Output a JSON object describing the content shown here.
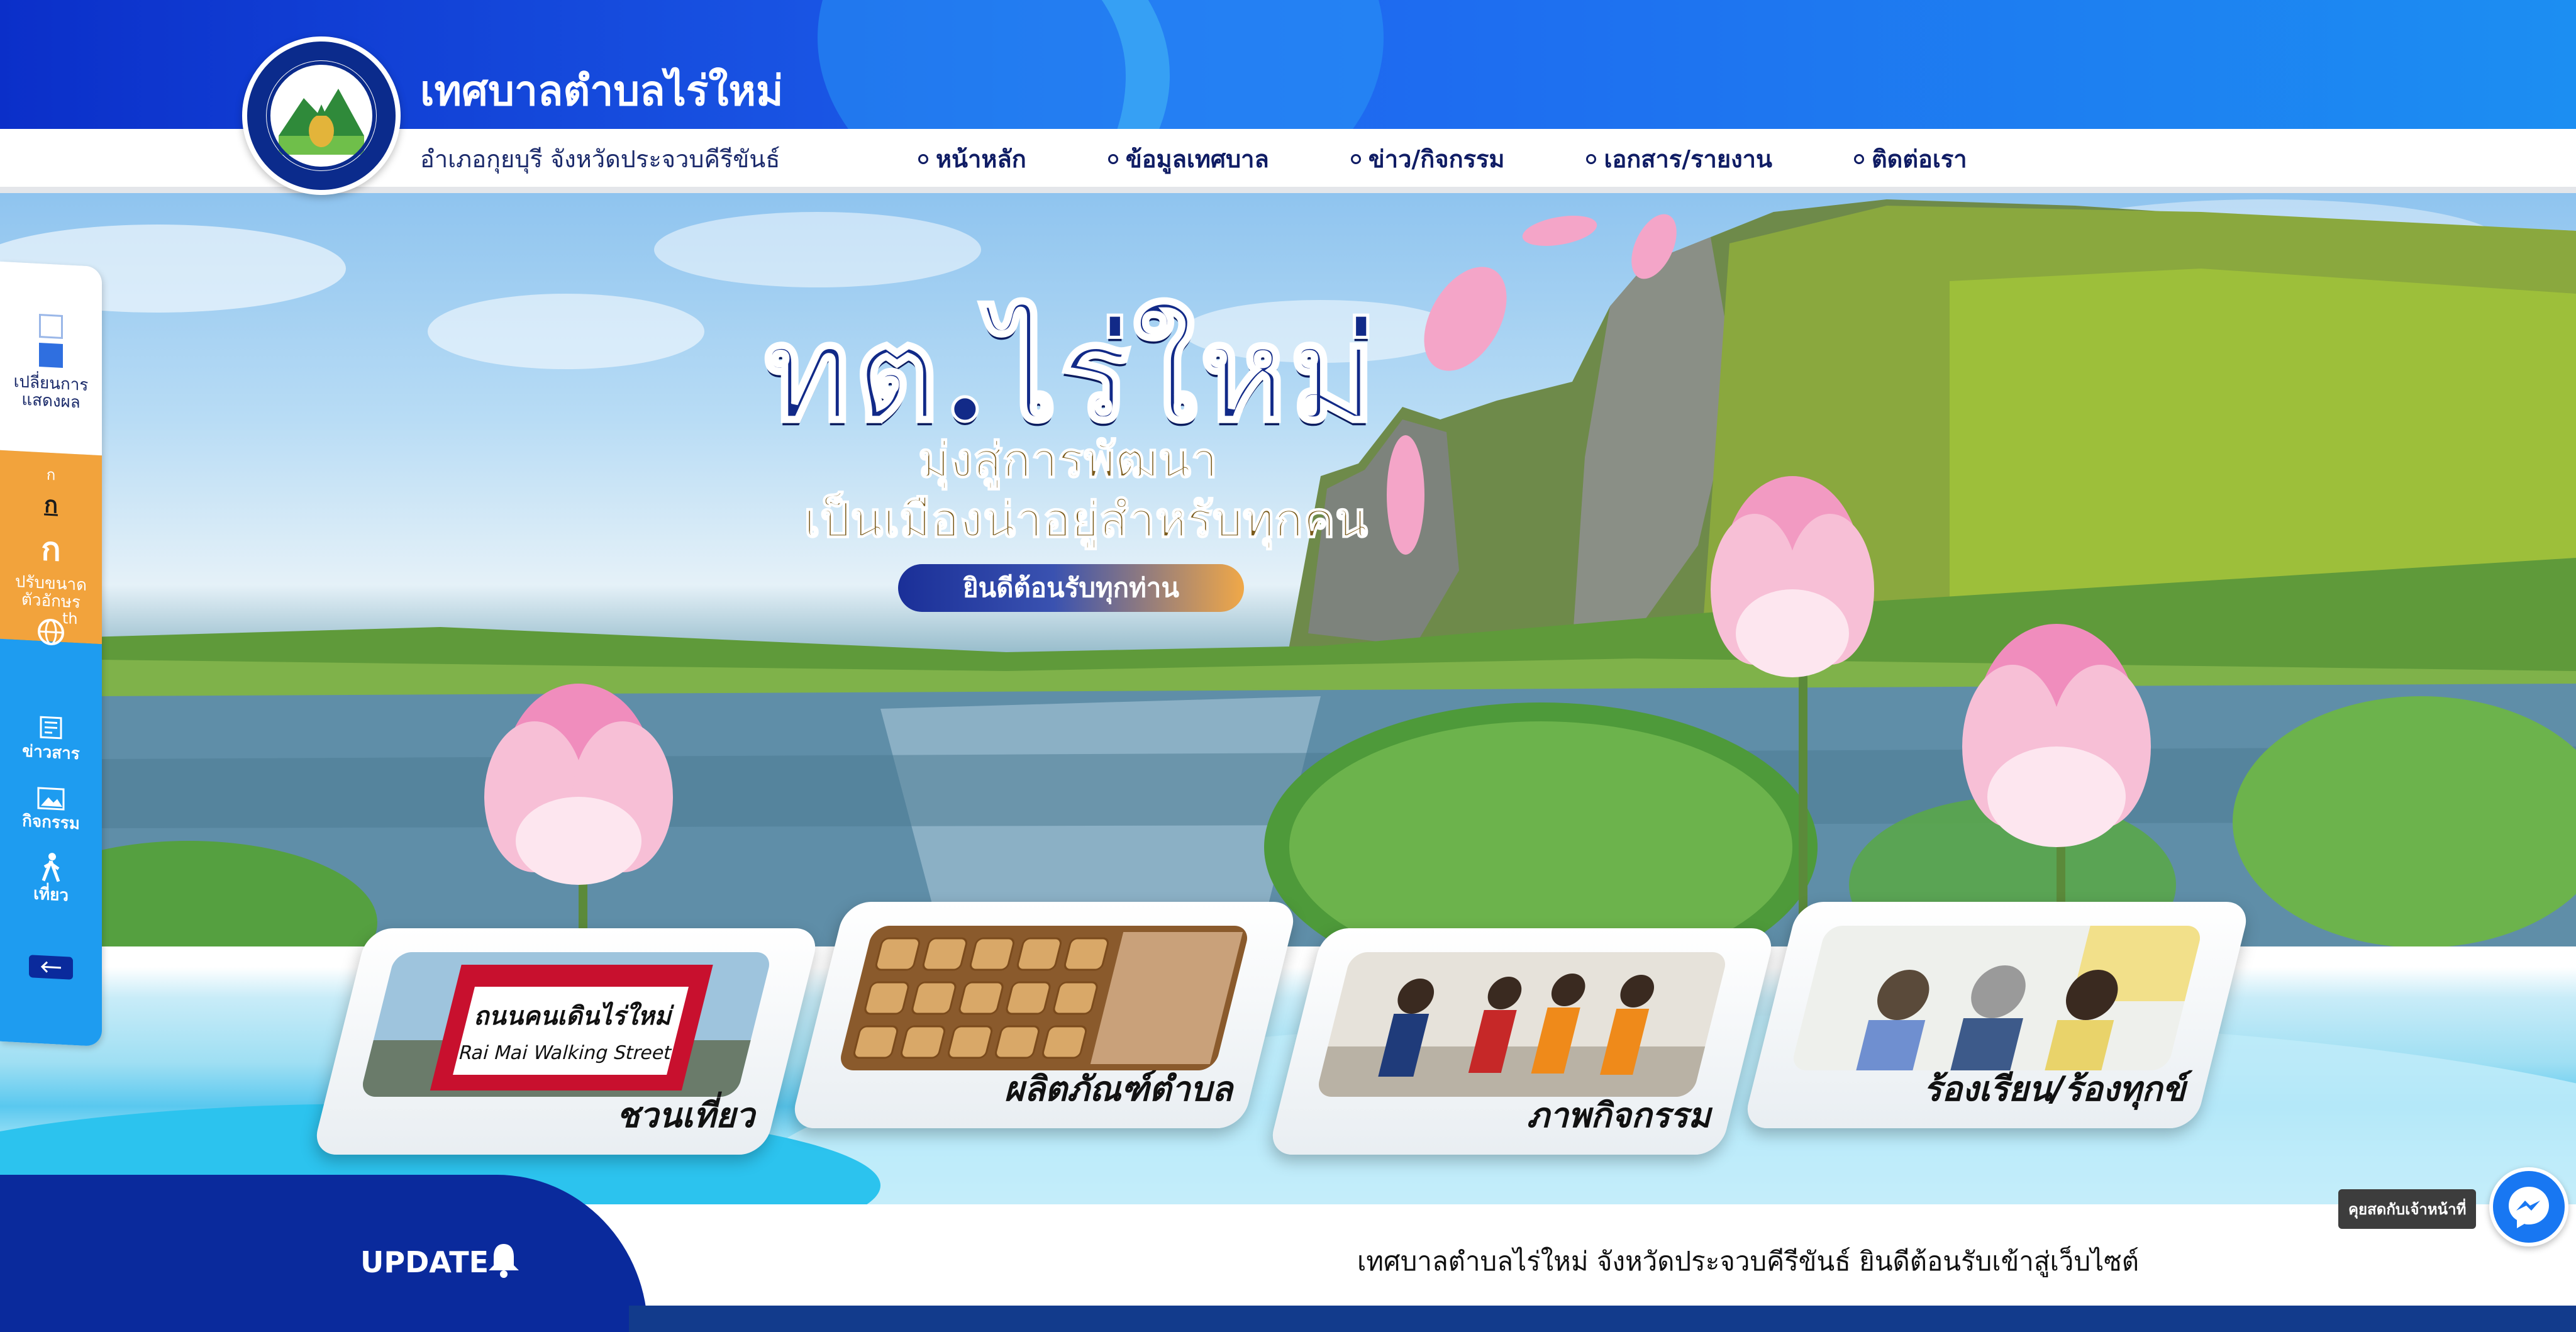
{
  "header": {
    "site_title": "เทศบาลตำบลไร่ใหม่",
    "location": "อำเภอกุยบุรี   จังหวัดประจวบคีรีขันธ์",
    "logo_icon": "municipality-seal-icon",
    "nav": [
      {
        "label": "หน้าหลัก"
      },
      {
        "label": "ข้อมูลเทศบาล"
      },
      {
        "label": "ข่าว/กิจกรรม"
      },
      {
        "label": "เอกสาร/รายงาน"
      },
      {
        "label": "ติดต่อเรา"
      }
    ]
  },
  "hero": {
    "title": "ทต.ไร่ใหม่",
    "subtitle_1": "มุ่งสู่การพัฒนา",
    "subtitle_2": "เป็นเมืองน่าอยู่สำหรับทุกคน",
    "welcome": "ยินดีต้อนรับทุกท่าน"
  },
  "cards": [
    {
      "label": "ชวนเที่ยว",
      "sign_th": "ถนนคนเดินไร่ใหม่",
      "sign_en": "Rai Mai Walking Street"
    },
    {
      "label": "ผลิตภัณฑ์ตำบล"
    },
    {
      "label": "ภาพกิจกรรม"
    },
    {
      "label": "ร้องเรียน/ร้องทุกข์"
    }
  ],
  "update": {
    "label": "UPDATE",
    "marquee": "เทศบาลตำบลไร่ใหม่ จังหวัดประจวบคีรีขันธ์ ยินดีต้อนรับเข้าสู่เว็บไซต์"
  },
  "toolbar": {
    "display_label_1": "เปลี่ยนการ",
    "display_label_2": "แสดงผล",
    "font_small": "ก",
    "font_medium": "ก",
    "font_large": "ก",
    "font_label_1": "ปรับขนาด",
    "font_label_2": "ตัวอักษร",
    "lang": "th",
    "news": "ข่าวสาร",
    "activity": "กิจกรรม",
    "travel": "เที่ยว"
  },
  "chat": {
    "tooltip": "คุยสดกับเจ้าหน้าที่"
  },
  "colors": {
    "header_blue": "#1f64ef",
    "navy": "#0a2a9c",
    "toolbar_orange": "#f2a33c",
    "toolbar_blue": "#1e9cf0",
    "messenger": "#1877f2"
  }
}
